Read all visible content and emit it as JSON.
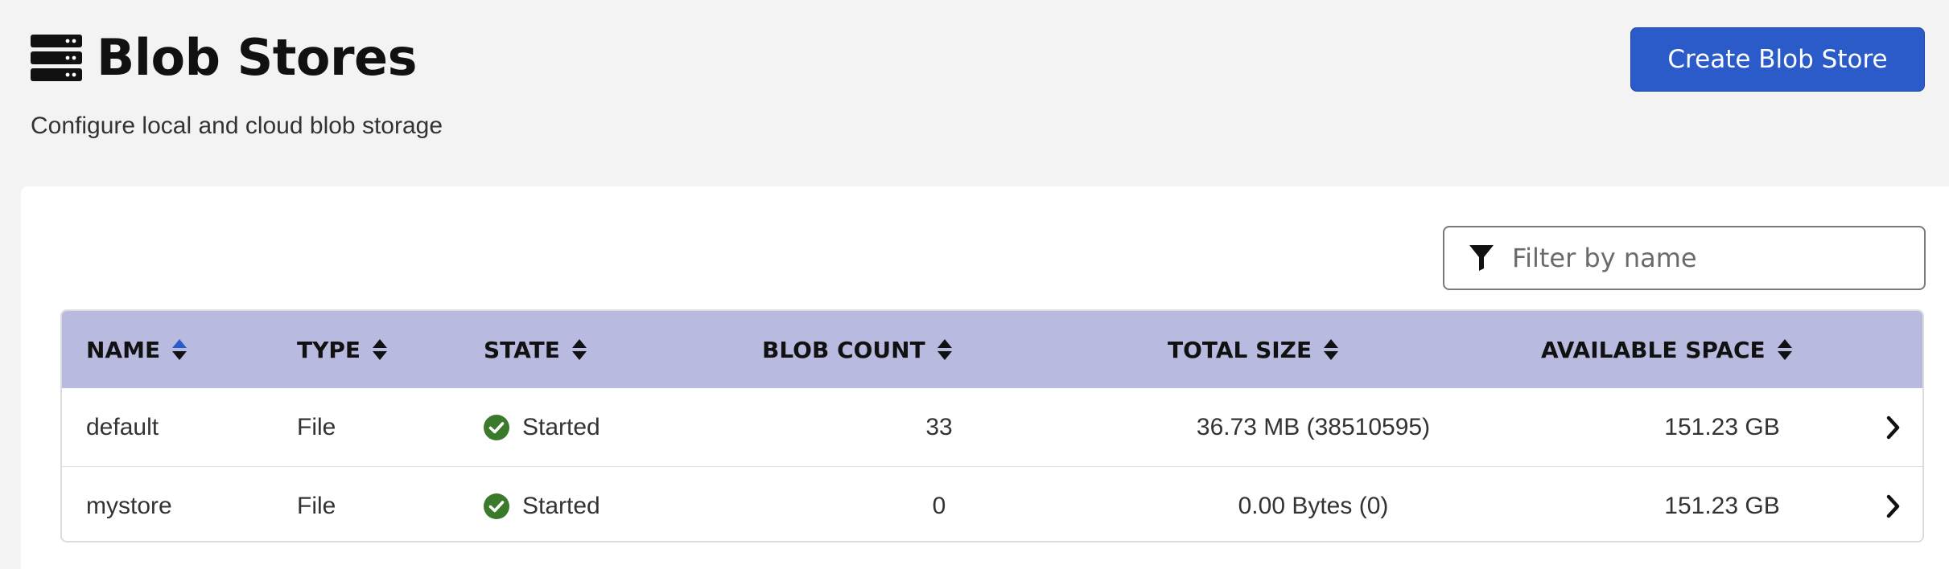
{
  "header": {
    "title": "Blob Stores",
    "subtitle": "Configure local and cloud blob storage",
    "title_icon": "database-servers-icon",
    "create_button_label": "Create Blob Store"
  },
  "filter": {
    "placeholder": "Filter by name",
    "value": "",
    "icon": "filter-icon"
  },
  "table": {
    "columns": [
      {
        "key": "name",
        "label": "NAME",
        "sort": "ascending"
      },
      {
        "key": "type",
        "label": "TYPE",
        "sort": "none"
      },
      {
        "key": "state",
        "label": "STATE",
        "sort": "none"
      },
      {
        "key": "blob_count",
        "label": "BLOB COUNT",
        "sort": "none"
      },
      {
        "key": "total_size",
        "label": "TOTAL SIZE",
        "sort": "none"
      },
      {
        "key": "available_space",
        "label": "AVAILABLE SPACE",
        "sort": "none"
      }
    ],
    "rows": [
      {
        "name": "default",
        "type": "File",
        "state": "Started",
        "blob_count": "33",
        "total_size": "36.73 MB (38510595)",
        "available_space": "151.23 GB"
      },
      {
        "name": "mystore",
        "type": "File",
        "state": "Started",
        "blob_count": "0",
        "total_size": "0.00 Bytes (0)",
        "available_space": "151.23 GB"
      }
    ]
  },
  "colors": {
    "primary": "#2a5bc9",
    "header_row": "#b8bbdf",
    "sort_active": "#2a5bc9",
    "status_ok": "#3b7a2a",
    "page_bg": "#f3f3f3"
  }
}
